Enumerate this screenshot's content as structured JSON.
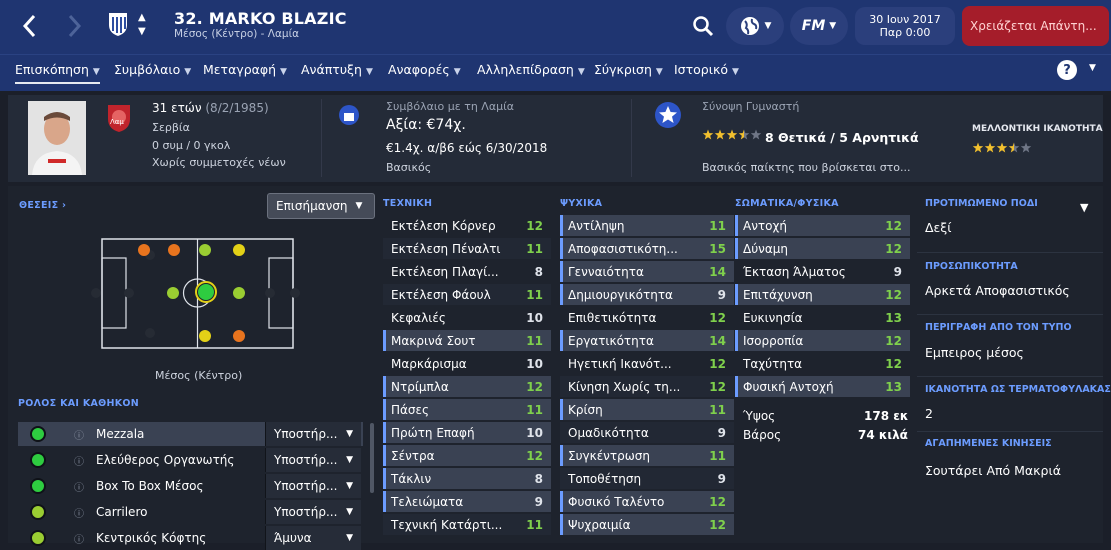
{
  "header": {
    "title": "32. MARKO BLAZIC",
    "subtitle": "Μέσος (Κέντρο) - Λαμία",
    "date": "30 Ιουν 2017",
    "time": "Παρ 0:00",
    "alert": "Χρειάζεται Απάντη..."
  },
  "nav": {
    "tabs": [
      {
        "label": "Επισκόπηση"
      },
      {
        "label": "Συμβόλαιο"
      },
      {
        "label": "Μεταγραφή"
      },
      {
        "label": "Ανάπτυξη"
      },
      {
        "label": "Αναφορές"
      },
      {
        "label": "Αλληλεπίδραση"
      },
      {
        "label": "Σύγκριση"
      },
      {
        "label": "Ιστορικό"
      }
    ],
    "help": "?"
  },
  "info": {
    "age": "31 ετών",
    "dob": "(8/2/1985)",
    "nation": "Σερβία",
    "caps": "0 συμ / 0 γκολ",
    "youth": "Χωρίς συμμετοχές νέων",
    "club_badge": "Λαμ",
    "contract_title": "Συμβόλαιο με τη Λαμία",
    "value": "Αξία: €74χ.",
    "wage": "€1.4χ. α/β6 εώς 6/30/2018",
    "contract_type": "Βασικός",
    "coach_title": "Σύνοψη Γυμναστή",
    "coach_summary": "8 Θετικά / 5 Αρνητικά",
    "coach_rating": 3.5,
    "coach_desc": "Βασικός παίκτης που βρίσκεται στο...",
    "potential_label": "ΜΕΛΛΟΝΤΙΚΗ ΙΚΑΝΟΤΗΤΑ",
    "potential_rating": 3.5
  },
  "positions": {
    "title": "ΘΕΣΕΙΣ",
    "highlight_btn": "Επισήμανση",
    "position_name": "Μέσος (Κέντρο)"
  },
  "roles": {
    "title": "ΡΟΛΟΣ ΚΑΙ ΚΑΘΗΚΟΝ",
    "items": [
      {
        "name": "Mezzala",
        "duty": "Υποστήρ...",
        "color": "#2ecc40"
      },
      {
        "name": "Ελεύθερος Οργανωτής",
        "duty": "Υποστήρ...",
        "color": "#2ecc40"
      },
      {
        "name": "Box To Box Μέσος",
        "duty": "Υποστήρ...",
        "color": "#2ecc40"
      },
      {
        "name": "Carrilero",
        "duty": "Υποστήρ...",
        "color": "#9acd32"
      },
      {
        "name": "Κεντρικός Κόφτης",
        "duty": "Άμυνα",
        "color": "#9acd32"
      }
    ]
  },
  "technical": {
    "title": "ΤΕΧΝΙΚΗ",
    "items": [
      {
        "name": "Εκτέλεση Κόρνερ",
        "value": "12"
      },
      {
        "name": "Εκτέλεση Πέναλτι",
        "value": "11"
      },
      {
        "name": "Εκτέλεση Πλαγί...",
        "value": "8"
      },
      {
        "name": "Εκτέλεση Φάουλ",
        "value": "11"
      },
      {
        "name": "Κεφαλιές",
        "value": "10"
      },
      {
        "name": "Μακρινά Σουτ",
        "value": "11"
      },
      {
        "name": "Μαρκάρισμα",
        "value": "10"
      },
      {
        "name": "Ντρίμπλα",
        "value": "12"
      },
      {
        "name": "Πάσες",
        "value": "11"
      },
      {
        "name": "Πρώτη Επαφή",
        "value": "10"
      },
      {
        "name": "Σέντρα",
        "value": "12"
      },
      {
        "name": "Τάκλιν",
        "value": "8"
      },
      {
        "name": "Τελειώματα",
        "value": "9"
      },
      {
        "name": "Τεχνική Κατάρτι...",
        "value": "11"
      }
    ]
  },
  "mental": {
    "title": "ΨΥΧΙΚΑ",
    "items": [
      {
        "name": "Αντίληψη",
        "value": "11"
      },
      {
        "name": "Αποφασιστικότη...",
        "value": "15"
      },
      {
        "name": "Γενναιότητα",
        "value": "14"
      },
      {
        "name": "Δημιουργικότητα",
        "value": "9"
      },
      {
        "name": "Επιθετικότητα",
        "value": "12"
      },
      {
        "name": "Εργατικότητα",
        "value": "14"
      },
      {
        "name": "Ηγετική Ικανότ...",
        "value": "12"
      },
      {
        "name": "Κίνηση Χωρίς τη...",
        "value": "12"
      },
      {
        "name": "Κρίση",
        "value": "11"
      },
      {
        "name": "Ομαδικότητα",
        "value": "9"
      },
      {
        "name": "Συγκέντρωση",
        "value": "11"
      },
      {
        "name": "Τοποθέτηση",
        "value": "9"
      },
      {
        "name": "Φυσικό Ταλέντο",
        "value": "12"
      },
      {
        "name": "Ψυχραιμία",
        "value": "12"
      }
    ]
  },
  "physical": {
    "title": "ΣΩΜΑΤΙΚΑ/ΦΥΣΙΚΑ",
    "items": [
      {
        "name": "Αντοχή",
        "value": "12"
      },
      {
        "name": "Δύναμη",
        "value": "12"
      },
      {
        "name": "Έκταση Άλματος",
        "value": "9"
      },
      {
        "name": "Επιτάχυνση",
        "value": "12"
      },
      {
        "name": "Ευκινησία",
        "value": "13"
      },
      {
        "name": "Ισορροπία",
        "value": "12"
      },
      {
        "name": "Ταχύτητα",
        "value": "12"
      },
      {
        "name": "Φυσική Αντοχή",
        "value": "13"
      }
    ],
    "height_label": "Ύψος",
    "height": "178 εκ",
    "weight_label": "Βάρος",
    "weight": "74 κιλά"
  },
  "right": {
    "foot_title": "ΠΡΟΤΙΜΩΜΕΝΟ ΠΟΔΙ",
    "foot": "Δεξί",
    "pers_title": "ΠΡΟΣΩΠΙΚΟΤΗΤΑ",
    "pers": "Αρκετά Αποφασιστικός",
    "media_title": "ΠΕΡΙΓΡΑΦΗ ΑΠΟ ΤΟΝ ΤΥΠΟ",
    "media": "Εμπειρος μέσος",
    "gk_title": "ΙΚΑΝΟΤΗΤΑ ΩΣ ΤΕΡΜΑΤΟΦΥΛΑΚΑΣ",
    "gk": "2",
    "moves_title": "ΑΓΑΠΗΜΕΝΕΣ ΚΙΝΗΣΕΙΣ",
    "moves": "Σουτάρει Από Μακριά"
  },
  "colors": {
    "header": "#1f3571",
    "accent": "#6c9cff",
    "good": "#7fd04c",
    "alert": "#a51d2a"
  }
}
